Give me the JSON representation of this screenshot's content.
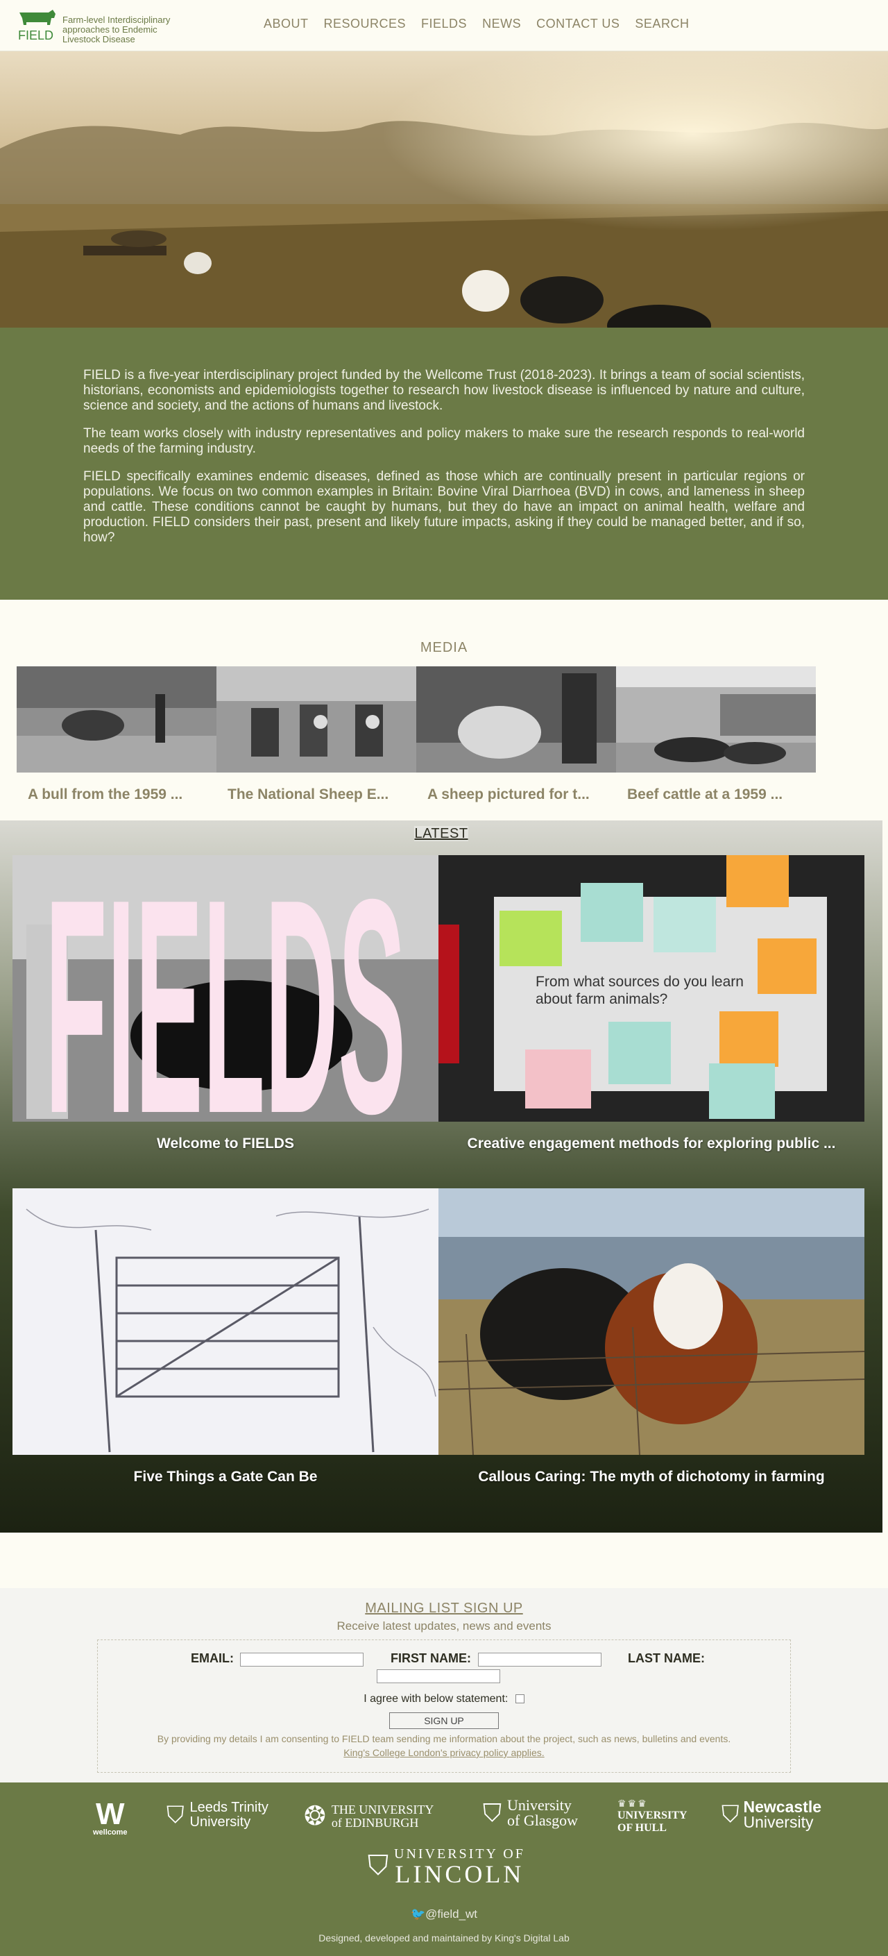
{
  "header": {
    "logo_text": "FIELD",
    "tagline": "Farm-level Interdisciplinary approaches to Endemic Livestock Disease",
    "nav": [
      "ABOUT",
      "RESOURCES",
      "FIELDS",
      "NEWS",
      "CONTACT US",
      "SEARCH"
    ]
  },
  "intro": {
    "paragraphs": [
      "FIELD is a five-year interdisciplinary project funded by the Wellcome Trust (2018-2023). It brings a team of social scientists, historians, economists and epidemiologists together to research how livestock disease is influenced by nature and culture, science and society, and the actions of humans and livestock.",
      "The team works closely with industry representatives and policy makers to make sure the research responds to real-world needs of the farming industry.",
      "FIELD specifically examines endemic diseases, defined as those which are continually present in particular regions or populations. We focus on two common examples in Britain: Bovine Viral Diarrhoea (BVD) in cows, and lameness in sheep and cattle. These conditions cannot be caught by humans, but they do have an impact on animal health, welfare and production. FIELD considers their past, present and likely future impacts, asking if they could be managed better, and if so, how?"
    ]
  },
  "media": {
    "heading": "MEDIA",
    "items": [
      {
        "title": "A bull from the 1959 ..."
      },
      {
        "title": "The National Sheep E..."
      },
      {
        "title": "A sheep pictured for t..."
      },
      {
        "title": "Beef cattle at a 1959 ..."
      }
    ]
  },
  "latest": {
    "heading": "LATEST",
    "fields_wordmark": "FIELDS",
    "sticky_note_text": "From what sources do you learn about farm animals?",
    "items": [
      {
        "title": "Welcome to FIELDS"
      },
      {
        "title": "Creative engagement methods for exploring public ..."
      },
      {
        "title": "Five Things a Gate Can Be"
      },
      {
        "title": "Callous Caring: The myth of dichotomy in farming"
      }
    ]
  },
  "mailing": {
    "title": "MAILING LIST SIGN UP",
    "subtitle": "Receive latest updates, news and events",
    "email_label": "EMAIL:",
    "first_name_label": "FIRST NAME:",
    "last_name_label": "LAST NAME:",
    "agree_label": "I agree with below statement:",
    "button_label": "SIGN UP",
    "consent": "By providing my details I am consenting to FIELD team sending me information about the project, such as news, bulletins and events.",
    "privacy_link": "King's College London's privacy policy applies."
  },
  "footer": {
    "partners": {
      "wellcome": "wellcome",
      "leeds1": "Leeds Trinity",
      "leeds2": "University",
      "edinburgh1": "THE UNIVERSITY",
      "edinburgh2": "of EDINBURGH",
      "glasgow1": "University",
      "glasgow2": "of Glasgow",
      "hull1": "UNIVERSITY",
      "hull2": "OF HULL",
      "newcastle1": "Newcastle",
      "newcastle2": "University",
      "lincoln1": "UNIVERSITY OF",
      "lincoln2": "LINCOLN"
    },
    "twitter": "@field_wt",
    "credit_prefix": "Designed, developed and maintained by",
    "credit_link": "King's Digital Lab"
  },
  "colors": {
    "olive": "#6b7a46",
    "cream": "#fdfcf3",
    "taupe": "#8c8466",
    "pink_wordmark": "#fbe3ee"
  }
}
